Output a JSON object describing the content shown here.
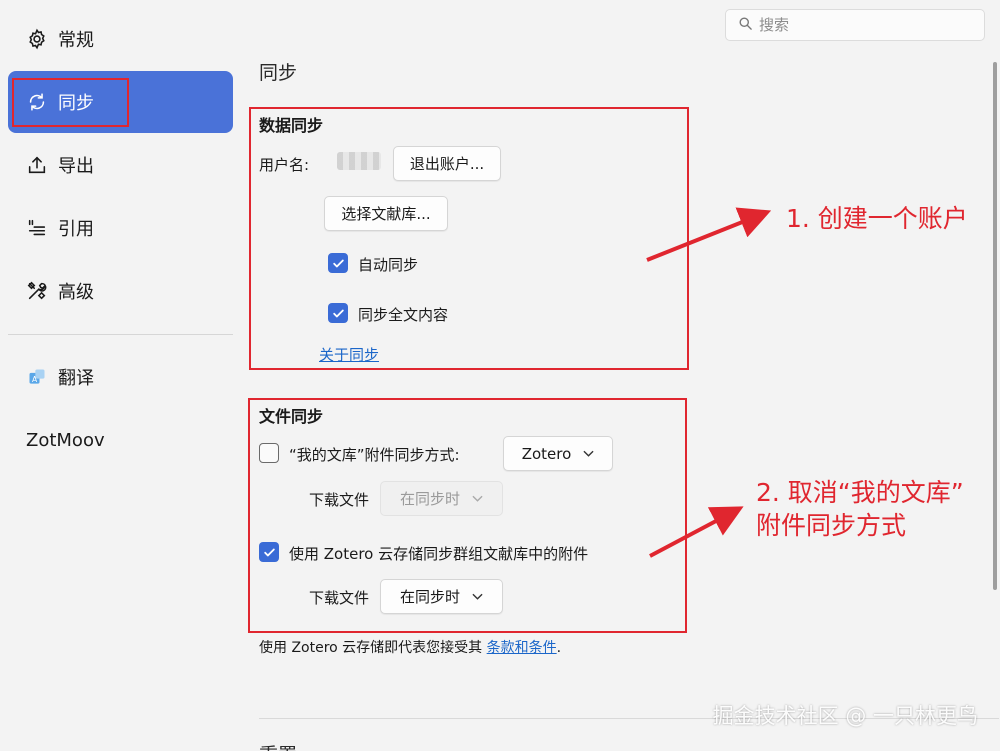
{
  "sidebar": {
    "items": [
      {
        "label": "常规",
        "icon": "gear-icon"
      },
      {
        "label": "同步",
        "icon": "sync-icon",
        "active": true
      },
      {
        "label": "导出",
        "icon": "export-icon"
      },
      {
        "label": "引用",
        "icon": "cite-icon"
      },
      {
        "label": "高级",
        "icon": "tools-icon"
      }
    ],
    "plugins": [
      {
        "label": "翻译",
        "icon": "translate-icon"
      },
      {
        "label": "ZotMoov"
      }
    ]
  },
  "search": {
    "placeholder": "搜索"
  },
  "page": {
    "title": "同步"
  },
  "data_sync": {
    "title": "数据同步",
    "username_label": "用户名:",
    "logout_button": "退出账户...",
    "choose_library_button": "选择文献库...",
    "auto_sync_label": "自动同步",
    "auto_sync_checked": true,
    "fulltext_sync_label": "同步全文内容",
    "fulltext_sync_checked": true,
    "about_link": "关于同步"
  },
  "file_sync": {
    "title": "文件同步",
    "my_library_label": "“我的文库”附件同步方式:",
    "my_library_checked": false,
    "my_library_method": "Zotero",
    "download_label_1": "下载文件",
    "download_option_1": "在同步时",
    "group_label": "使用 Zotero 云存储同步群组文献库中的附件",
    "group_checked": true,
    "download_label_2": "下载文件",
    "download_option_2": "在同步时"
  },
  "terms": {
    "prefix": "使用 Zotero 云存储即代表您接受其",
    "link": "条款和条件",
    "suffix": "."
  },
  "annotations": {
    "note1": "1. 创建一个账户",
    "note2_line1": "2. 取消“我的文库”",
    "note2_line2": "附件同步方式"
  },
  "next_section_title": "重置",
  "watermark": "掘金技术社区 @ 一只林更鸟",
  "colors": {
    "accent": "#4a72d8",
    "checkbox": "#3a6bd6",
    "annotation": "#e0262f",
    "link": "#1b66c9"
  }
}
